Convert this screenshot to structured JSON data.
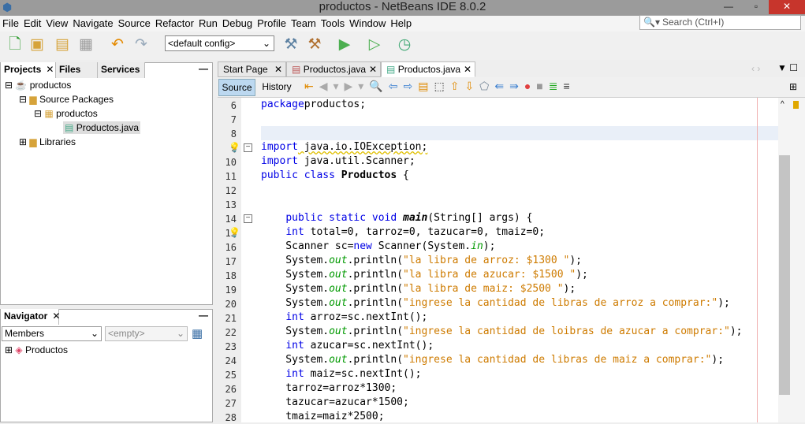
{
  "window": {
    "title": "productos - NetBeans IDE 8.0.2"
  },
  "menu": [
    "File",
    "Edit",
    "View",
    "Navigate",
    "Source",
    "Refactor",
    "Run",
    "Debug",
    "Profile",
    "Team",
    "Tools",
    "Window",
    "Help"
  ],
  "search": {
    "placeholder": "Search (Ctrl+I)"
  },
  "toolbar": {
    "config": "<default config>"
  },
  "projects_panel": {
    "tabs": [
      "Projects",
      "Files",
      "Services"
    ],
    "tree": [
      "productos",
      "Source Packages",
      "productos",
      "Productos.java",
      "Libraries"
    ]
  },
  "navigator": {
    "title": "Navigator",
    "members": "Members",
    "filter": "<empty>",
    "root": "Productos"
  },
  "editor": {
    "tabs": [
      "Start Page",
      "Productos.java",
      "Productos.java"
    ],
    "source": "Source",
    "history": "History",
    "lines": [
      {
        "n": "6",
        "t": [
          [
            "kw",
            "package"
          ],
          [
            "",
            "productos;"
          ]
        ]
      },
      {
        "n": "7",
        "t": []
      },
      {
        "n": "8",
        "t": []
      },
      {
        "n": "9",
        "t": [
          [
            "kw",
            "import"
          ],
          [
            "",
            " java.io.IOException;"
          ]
        ]
      },
      {
        "n": "10",
        "t": [
          [
            "kw",
            "import"
          ],
          [
            "",
            " java.util.Scanner;"
          ]
        ]
      },
      {
        "n": "11",
        "t": [
          [
            "kw",
            "public class"
          ],
          [
            "",
            " "
          ],
          [
            "bo",
            "Productos"
          ],
          [
            "",
            " {"
          ]
        ]
      },
      {
        "n": "12",
        "t": []
      },
      {
        "n": "13",
        "t": []
      },
      {
        "n": "14",
        "t": [
          [
            "",
            "    "
          ],
          [
            "kw",
            "public static void"
          ],
          [
            "",
            " "
          ],
          [
            "bi",
            "main"
          ],
          [
            "",
            "(String[] args) {"
          ]
        ]
      },
      {
        "n": "15",
        "t": [
          [
            "",
            "    "
          ],
          [
            "kw",
            "int"
          ],
          [
            "",
            " total=0, tarroz=0, tazucar=0, tmaiz=0;"
          ]
        ]
      },
      {
        "n": "16",
        "t": [
          [
            "",
            "    Scanner sc="
          ],
          [
            "kw",
            "new"
          ],
          [
            "",
            " Scanner(System."
          ],
          [
            "fld",
            "in"
          ],
          [
            "",
            ");"
          ]
        ]
      },
      {
        "n": "17",
        "t": [
          [
            "",
            "    System."
          ],
          [
            "fld",
            "out"
          ],
          [
            "",
            ".println("
          ],
          [
            "st",
            "\"la libra de arroz: $1300 \""
          ],
          [
            "",
            ");"
          ]
        ]
      },
      {
        "n": "18",
        "t": [
          [
            "",
            "    System."
          ],
          [
            "fld",
            "out"
          ],
          [
            "",
            ".println("
          ],
          [
            "st",
            "\"la libra de azucar: $1500 \""
          ],
          [
            "",
            ");"
          ]
        ]
      },
      {
        "n": "19",
        "t": [
          [
            "",
            "    System."
          ],
          [
            "fld",
            "out"
          ],
          [
            "",
            ".println("
          ],
          [
            "st",
            "\"la libra de maiz: $2500 \""
          ],
          [
            "",
            ");"
          ]
        ]
      },
      {
        "n": "20",
        "t": [
          [
            "",
            "    System."
          ],
          [
            "fld",
            "out"
          ],
          [
            "",
            ".println("
          ],
          [
            "st",
            "\"ingrese la cantidad de libras de arroz a comprar:\""
          ],
          [
            "",
            ");"
          ]
        ]
      },
      {
        "n": "21",
        "t": [
          [
            "",
            "    "
          ],
          [
            "kw",
            "int"
          ],
          [
            "",
            " arroz=sc.nextInt();"
          ]
        ]
      },
      {
        "n": "22",
        "t": [
          [
            "",
            "    System."
          ],
          [
            "fld",
            "out"
          ],
          [
            "",
            ".println("
          ],
          [
            "st",
            "\"ingrese la cantidad de loibras de azucar a comprar:\""
          ],
          [
            "",
            ");"
          ]
        ]
      },
      {
        "n": "23",
        "t": [
          [
            "",
            "    "
          ],
          [
            "kw",
            "int"
          ],
          [
            "",
            " azucar=sc.nextInt();"
          ]
        ]
      },
      {
        "n": "24",
        "t": [
          [
            "",
            "    System."
          ],
          [
            "fld",
            "out"
          ],
          [
            "",
            ".println("
          ],
          [
            "st",
            "\"ingrese la cantidad de libras de maiz a comprar:\""
          ],
          [
            "",
            ");"
          ]
        ]
      },
      {
        "n": "25",
        "t": [
          [
            "",
            "    "
          ],
          [
            "kw",
            "int"
          ],
          [
            "",
            " maiz=sc.nextInt();"
          ]
        ]
      },
      {
        "n": "26",
        "t": [
          [
            "",
            "    tarroz=arroz*1300;"
          ]
        ]
      },
      {
        "n": "27",
        "t": [
          [
            "",
            "    tazucar=azucar*1500;"
          ]
        ]
      },
      {
        "n": "28",
        "t": [
          [
            "",
            "    tmaiz=maiz*2500;"
          ]
        ]
      }
    ]
  }
}
